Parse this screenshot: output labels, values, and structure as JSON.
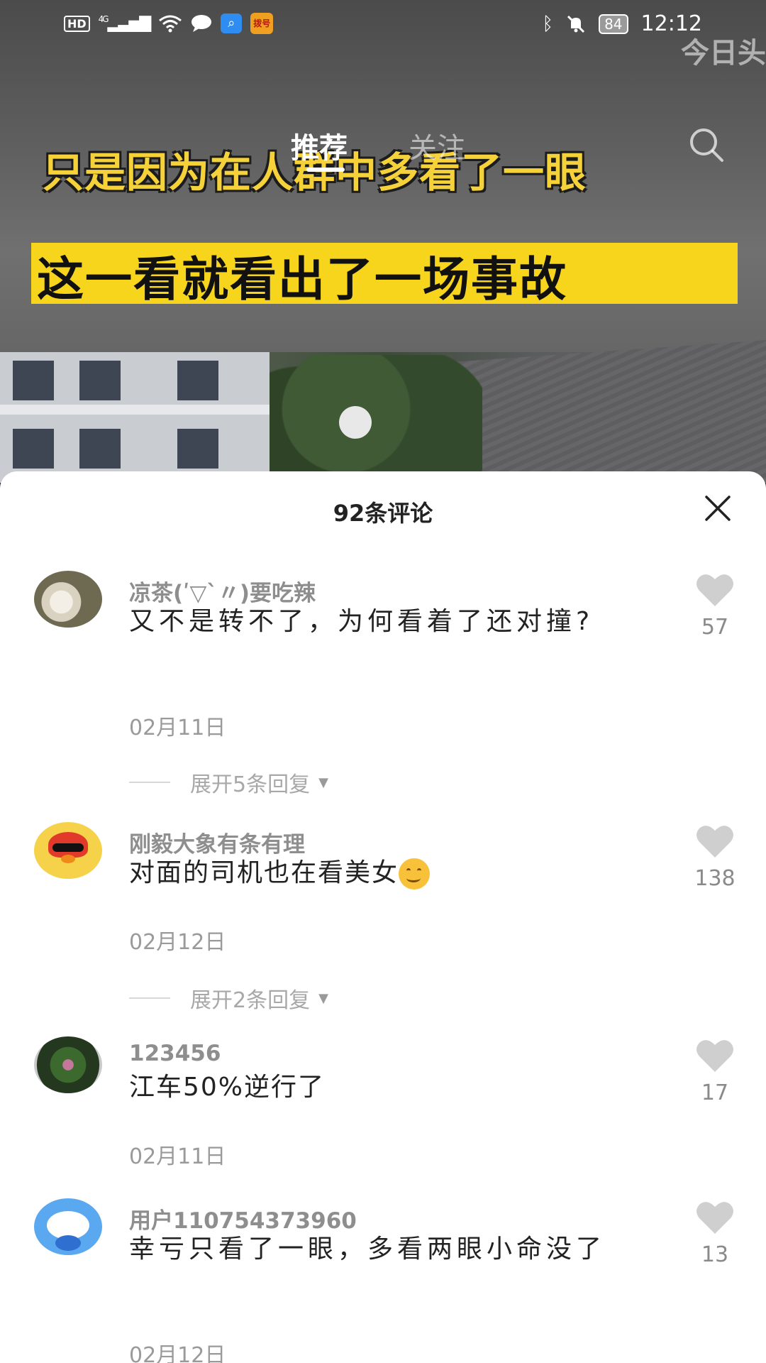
{
  "status_bar": {
    "hd": "HD",
    "network": "4G",
    "battery": "84",
    "time": "12:12",
    "app_badge": "拨号",
    "icons": [
      "signal-icon",
      "wifi-icon",
      "message-icon",
      "search-app-icon",
      "bluetooth-icon",
      "mute-icon",
      "battery-icon"
    ]
  },
  "watermark": "今日头",
  "nav": {
    "tabs": [
      {
        "label": "推荐",
        "active": true
      },
      {
        "label": "关注",
        "active": false
      }
    ]
  },
  "video": {
    "caption_line1": "只是因为在人群中多看了一眼",
    "caption_line2": "这一看就看出了一场事故"
  },
  "comments_panel": {
    "title": "92条评论",
    "comments": [
      {
        "user": "凉茶(ʹ▽`〃)要吃辣",
        "text": "又不是转不了，为何看着了还对撞?",
        "date": "02月11日",
        "likes": "57",
        "replies": "展开5条回复"
      },
      {
        "user": "刚毅大象有条有理",
        "text": "对面的司机也在看美女",
        "date": "02月12日",
        "likes": "138",
        "replies": "展开2条回复"
      },
      {
        "user": "123456",
        "text": "江车50%逆行了",
        "date": "02月11日",
        "likes": "17"
      },
      {
        "user": "用户110754373960",
        "text": "幸亏只看了一眼，多看两眼小命没了",
        "date": "02月12日",
        "likes": "13"
      }
    ]
  },
  "colors": {
    "caption_yellow": "#f6d23a",
    "caption_box": "#f7d51d",
    "username_gray": "#8e8e8e",
    "text_dark": "#222222"
  }
}
